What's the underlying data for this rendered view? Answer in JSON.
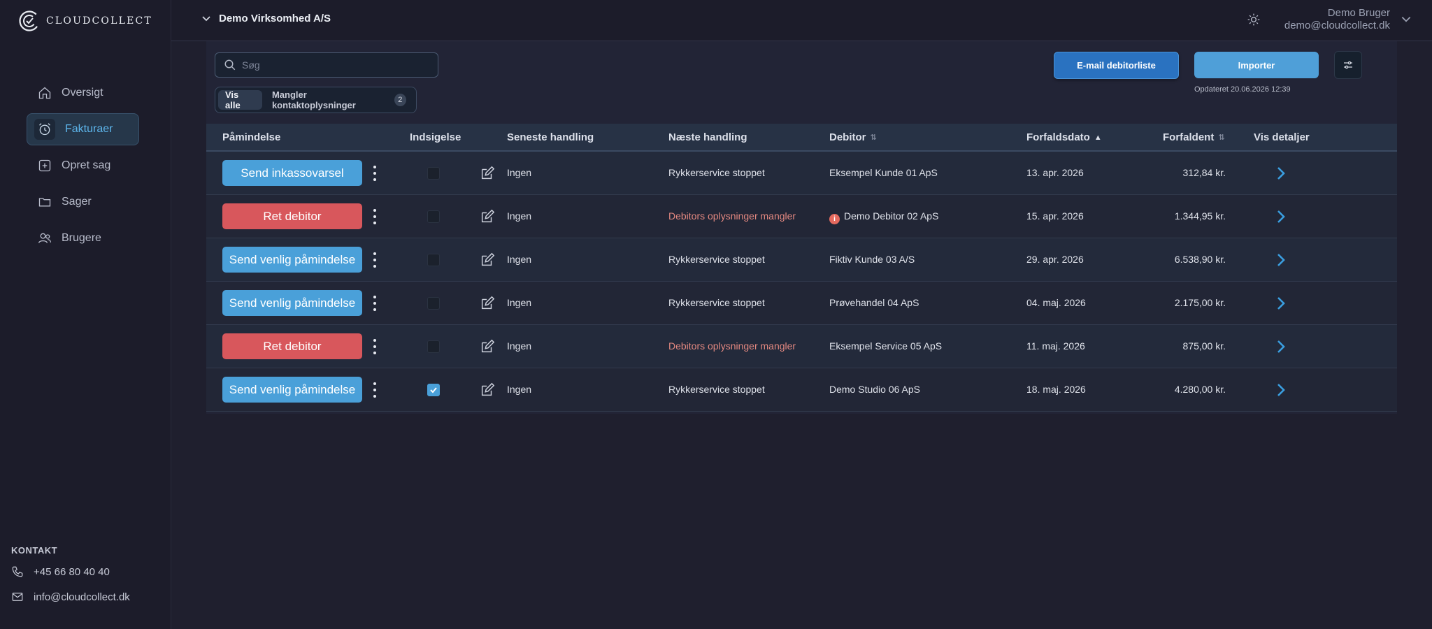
{
  "brand": {
    "logo_text": "CLOUDCOLLECT"
  },
  "sidebar": {
    "items": [
      {
        "label": "Oversigt",
        "icon": "home-icon"
      },
      {
        "label": "Fakturaer",
        "icon": "alarm-clock-icon",
        "active": true
      },
      {
        "label": "Opret sag",
        "icon": "plus-square-icon"
      },
      {
        "label": "Sager",
        "icon": "folder-icon"
      },
      {
        "label": "Brugere",
        "icon": "users-icon"
      }
    ],
    "contact": {
      "title": "KONTAKT",
      "phone": "+45 66 80 40 40",
      "email": "info@cloudcollect.dk"
    }
  },
  "topbar": {
    "company": "Demo Virksomhed A/S",
    "user_name": "Demo Bruger",
    "user_email": "demo@cloudcollect.dk"
  },
  "toolbar": {
    "search_placeholder": "Søg",
    "filter_all": "Vis alle",
    "filter_missing": "Mangler kontaktoplysninger",
    "filter_missing_count": "2",
    "email_button": "E-mail debitorliste",
    "import_button": "Importer",
    "updated_text": "Opdateret 20.06.2026 12:39"
  },
  "table": {
    "headers": {
      "reminder": "Påmindelse",
      "notice": "Indsigelse",
      "last_action": "Seneste handling",
      "next_action": "Næste handling",
      "debtor": "Debitor",
      "due_date": "Forfaldsdato",
      "amount": "Forfaldent",
      "details": "Vis detaljer"
    },
    "rows": [
      {
        "action": "Send inkassovarsel",
        "action_color": "blue",
        "checked": false,
        "last_action": "Ingen",
        "next_action": "Rykkerservice stoppet",
        "next_warn": false,
        "debtor": "Eksempel Kunde 01 ApS",
        "debtor_warn": false,
        "due_date": "13. apr. 2026",
        "amount": "312,84 kr."
      },
      {
        "action": "Ret debitor",
        "action_color": "red",
        "checked": false,
        "last_action": "Ingen",
        "next_action": "Debitors oplysninger mangler",
        "next_warn": true,
        "debtor": "Demo Debitor 02 ApS",
        "debtor_warn": true,
        "due_date": "15. apr. 2026",
        "amount": "1.344,95 kr."
      },
      {
        "action": "Send venlig påmindelse",
        "action_color": "blue",
        "checked": false,
        "last_action": "Ingen",
        "next_action": "Rykkerservice stoppet",
        "next_warn": false,
        "debtor": "Fiktiv Kunde 03 A/S",
        "debtor_warn": false,
        "due_date": "29. apr. 2026",
        "amount": "6.538,90 kr."
      },
      {
        "action": "Send venlig påmindelse",
        "action_color": "blue",
        "checked": false,
        "last_action": "Ingen",
        "next_action": "Rykkerservice stoppet",
        "next_warn": false,
        "debtor": "Prøvehandel 04 ApS",
        "debtor_warn": false,
        "due_date": "04. maj. 2026",
        "amount": "2.175,00 kr."
      },
      {
        "action": "Ret debitor",
        "action_color": "red",
        "checked": false,
        "last_action": "Ingen",
        "next_action": "Debitors oplysninger mangler",
        "next_warn": true,
        "debtor": "Eksempel Service 05 ApS",
        "debtor_warn": false,
        "due_date": "11. maj. 2026",
        "amount": "875,00 kr."
      },
      {
        "action": "Send venlig påmindelse",
        "action_color": "blue",
        "checked": true,
        "last_action": "Ingen",
        "next_action": "Rykkerservice stoppet",
        "next_warn": false,
        "debtor": "Demo Studio 06 ApS",
        "debtor_warn": false,
        "due_date": "18. maj. 2026",
        "amount": "4.280,00 kr."
      }
    ]
  },
  "colors": {
    "accent": "#4aa0d9",
    "danger": "#d8575c",
    "warning_text": "#e38880",
    "background": "#1f1f2e"
  }
}
